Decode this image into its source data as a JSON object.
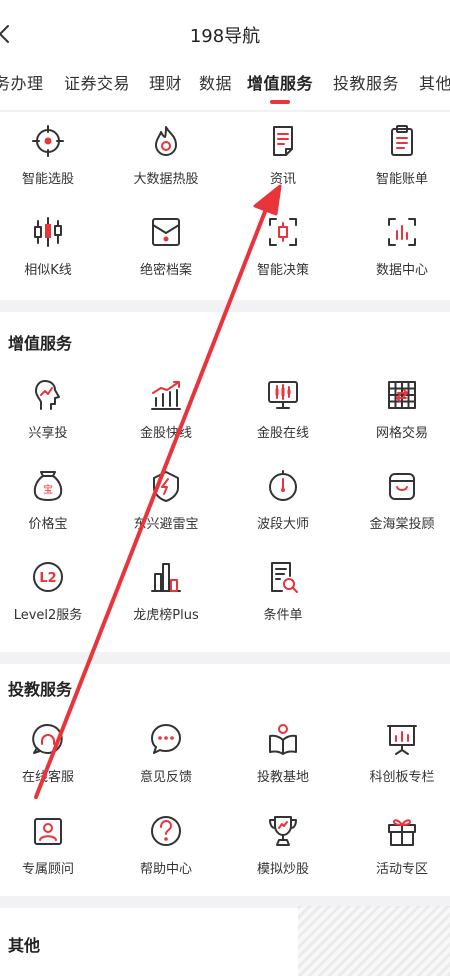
{
  "header": {
    "title": "198导航"
  },
  "tabs": [
    {
      "label": "务办理"
    },
    {
      "label": "证券交易"
    },
    {
      "label": "理财"
    },
    {
      "label": "数据"
    },
    {
      "label": "增值服务"
    },
    {
      "label": "投教服务"
    },
    {
      "label": "其他"
    }
  ],
  "active_tab": "增值服务",
  "top_grid": [
    {
      "label": "智能选股",
      "icon": "target-icon"
    },
    {
      "label": "大数据热股",
      "icon": "flame-icon"
    },
    {
      "label": "资讯",
      "icon": "news-icon"
    },
    {
      "label": "智能账单",
      "icon": "clipboard-icon"
    },
    {
      "label": "相似K线",
      "icon": "candlestick-icon"
    },
    {
      "label": "绝密档案",
      "icon": "secret-envelope-icon"
    },
    {
      "label": "智能决策",
      "icon": "decision-icon"
    },
    {
      "label": "数据中心",
      "icon": "data-center-icon"
    }
  ],
  "value_added": {
    "title": "增值服务",
    "items": [
      {
        "label": "兴享投",
        "icon": "head-chart-icon"
      },
      {
        "label": "金股快线",
        "icon": "bar-trend-icon"
      },
      {
        "label": "金股在线",
        "icon": "monitor-candle-icon"
      },
      {
        "label": "网格交易",
        "icon": "grid-icon"
      },
      {
        "label": "价格宝",
        "icon": "money-bag-icon"
      },
      {
        "label": "东兴避雷宝",
        "icon": "shield-bolt-icon"
      },
      {
        "label": "波段大师",
        "icon": "timer-icon"
      },
      {
        "label": "金海棠投顾",
        "icon": "bag-icon"
      },
      {
        "label": "Level2服务",
        "icon": "level2-icon"
      },
      {
        "label": "龙虎榜Plus",
        "icon": "ranking-bars-icon"
      },
      {
        "label": "条件单",
        "icon": "document-search-icon"
      }
    ]
  },
  "education": {
    "title": "投教服务",
    "items": [
      {
        "label": "在线客服",
        "icon": "chat-headset-icon"
      },
      {
        "label": "意见反馈",
        "icon": "speech-bubble-icon"
      },
      {
        "label": "投教基地",
        "icon": "reading-person-icon"
      },
      {
        "label": "科创板专栏",
        "icon": "presentation-icon"
      },
      {
        "label": "专属顾问",
        "icon": "advisor-icon"
      },
      {
        "label": "帮助中心",
        "icon": "question-icon"
      },
      {
        "label": "模拟炒股",
        "icon": "trophy-icon"
      },
      {
        "label": "活动专区",
        "icon": "gift-icon"
      }
    ]
  },
  "other": {
    "title": "其他"
  },
  "accent_color": "#e8343a"
}
